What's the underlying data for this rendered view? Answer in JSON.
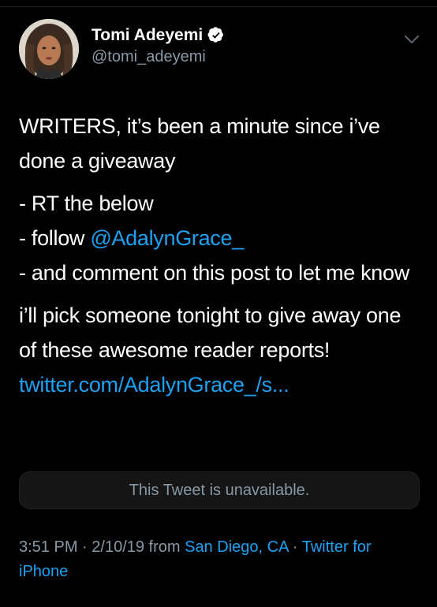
{
  "author": {
    "name": "Tomi Adeyemi",
    "handle": "@tomi_adeyemi",
    "verified": true
  },
  "icons": {
    "verified": "verified-badge-icon",
    "menu": "chevron-down-icon",
    "avatar": "profile-photo"
  },
  "tweet": {
    "para1": "WRITERS, it’s been a minute since i’ve done a giveaway",
    "item1": "- RT the below",
    "item2_prefix": "- follow ",
    "item2_mention": "@AdalynGrace_",
    "item3": "- and comment on this post to let me know",
    "para3": "i’ll pick someone tonight to give away one of these awesome reader reports!",
    "link": "twitter.com/AdalynGrace_/s..."
  },
  "quoted_tweet": {
    "text": "This Tweet is unavailable."
  },
  "meta": {
    "time": "3:51 PM",
    "separator1": " · ",
    "date": "2/10/19",
    "from": " from ",
    "location": "San Diego, CA",
    "separator2": " · ",
    "client": "Twitter for iPhone"
  },
  "colors": {
    "background": "#000000",
    "text": "#ffffff",
    "secondary": "#8899a6",
    "link": "#1da1f2"
  }
}
